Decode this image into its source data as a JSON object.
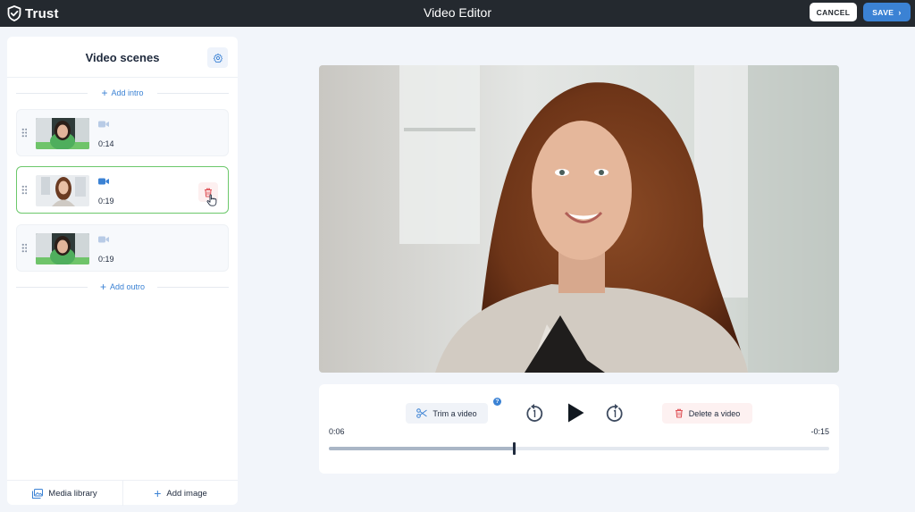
{
  "header": {
    "logo_text": "Trust",
    "title": "Video Editor",
    "cancel_label": "CANCEL",
    "save_label": "SAVE"
  },
  "sidebar": {
    "title": "Video scenes",
    "add_intro_label": "Add intro",
    "add_outro_label": "Add outro",
    "scenes": [
      {
        "duration": "0:14",
        "selected": false
      },
      {
        "duration": "0:19",
        "selected": true
      },
      {
        "duration": "0:19",
        "selected": false
      }
    ],
    "footer": {
      "media_library_label": "Media library",
      "add_image_label": "Add image"
    }
  },
  "player": {
    "trim_label": "Trim a video",
    "help_label": "?",
    "delete_label": "Delete a video",
    "current_time": "0:06",
    "remaining_time": "-0:15",
    "progress": 0.37
  },
  "colors": {
    "topbar": "#24292f",
    "accent": "#3b82d4",
    "selected_border": "#6cc86b",
    "danger": "#e0555a"
  }
}
